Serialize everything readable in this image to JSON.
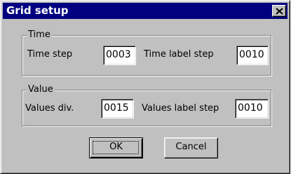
{
  "window": {
    "title": "Grid setup",
    "close_icon": "close-x-icon"
  },
  "time_group": {
    "legend": "Time",
    "time_step_label": "Time step",
    "time_step_value": "0003",
    "time_label_step_label": "Time label step",
    "time_label_step_value": "0010"
  },
  "value_group": {
    "legend": "Value",
    "values_div_label": "Values div.",
    "values_div_value": "0015",
    "values_label_step_label": "Values label step",
    "values_label_step_value": "0010"
  },
  "buttons": {
    "ok_label": "OK",
    "cancel_label": "Cancel"
  },
  "colors": {
    "titlebar": "#000080",
    "face": "#c0c0c0",
    "field": "#ffffff"
  }
}
